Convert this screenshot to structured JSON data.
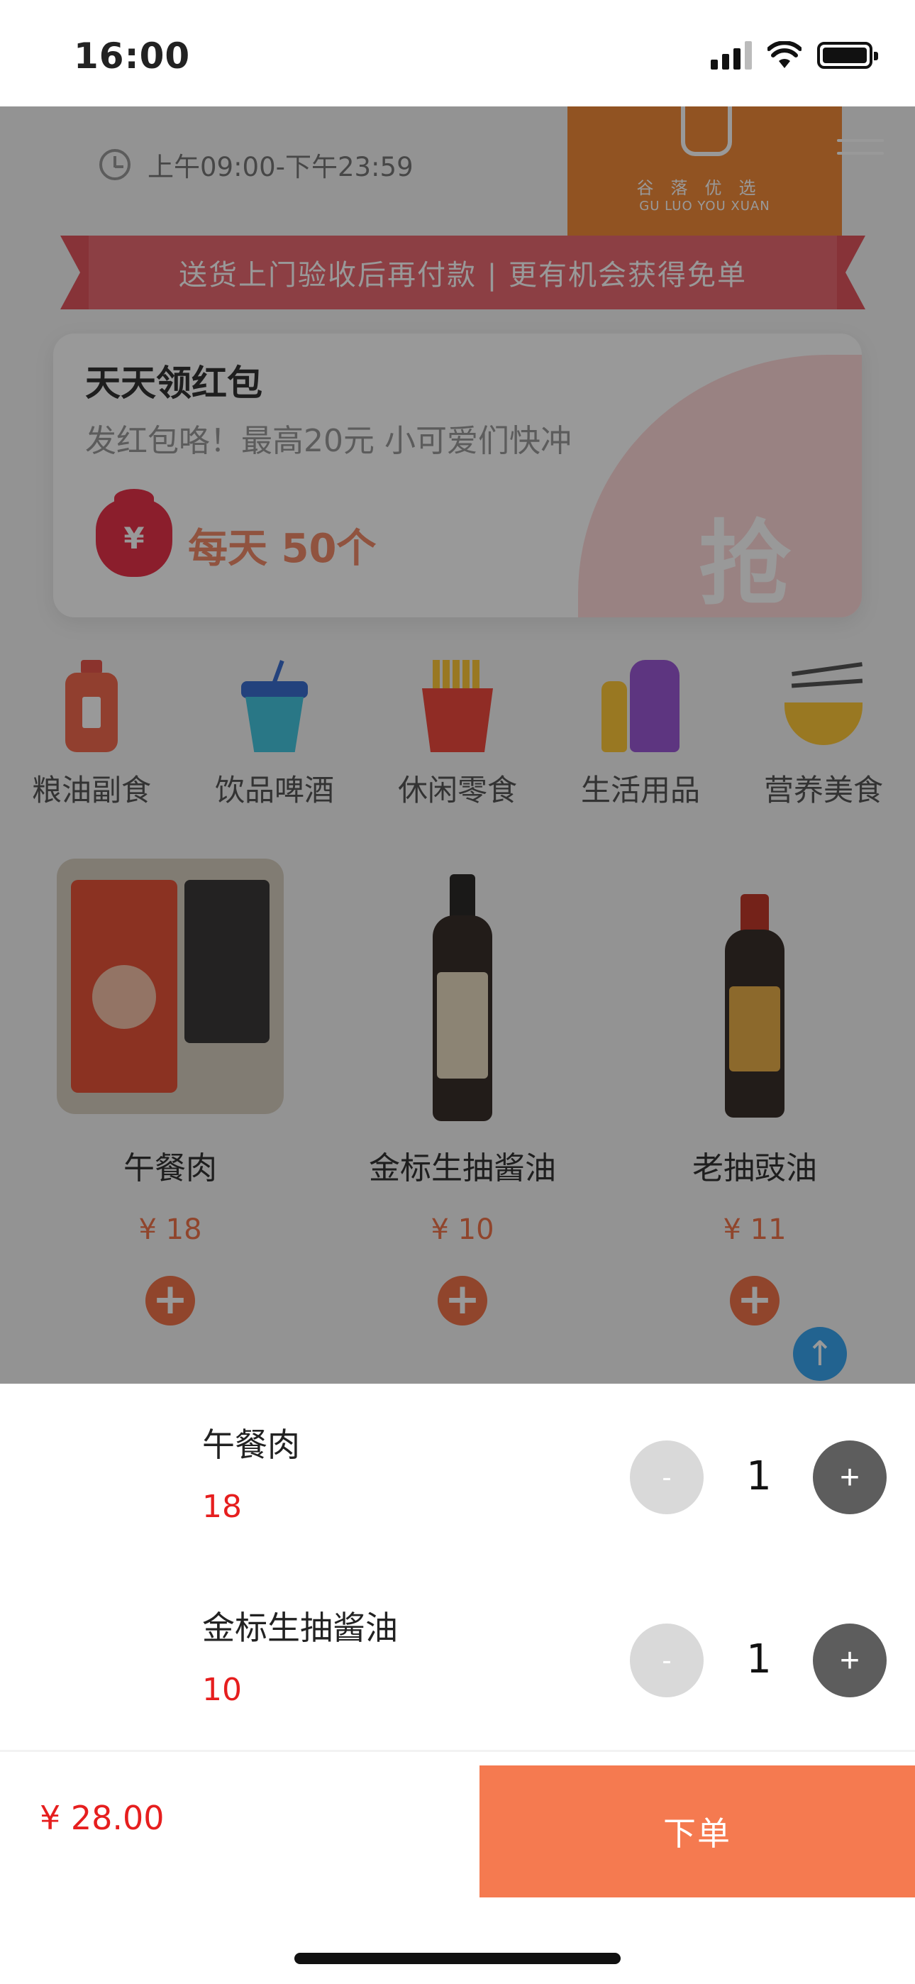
{
  "status_bar": {
    "time": "16:00"
  },
  "store": {
    "hours": "上午09:00-下午23:59",
    "logo_cn": "谷落优选",
    "logo_en": "GU LUO YOU XUAN"
  },
  "banner": {
    "text": "送货上门验收后再付款 | 更有机会获得免单"
  },
  "promo": {
    "title": "天天领红包",
    "subtitle": "发红包咯！最高20元 小可爱们快冲",
    "bag_symbol": "¥",
    "daily": "每天 50个",
    "grab": "抢"
  },
  "categories": [
    {
      "label": "粮油副食",
      "icon": "oil-bottle-icon"
    },
    {
      "label": "饮品啤酒",
      "icon": "drink-cup-icon"
    },
    {
      "label": "休闲零食",
      "icon": "fries-icon"
    },
    {
      "label": "生活用品",
      "icon": "detergent-bottle-icon"
    },
    {
      "label": "营养美食",
      "icon": "noodle-bowl-icon"
    }
  ],
  "products": [
    {
      "name": "午餐肉",
      "price": "¥ 18",
      "add": "+"
    },
    {
      "name": "金标生抽酱油",
      "price": "¥ 10",
      "add": "+"
    },
    {
      "name": "老抽豉油",
      "price": "¥ 11",
      "add": "+"
    }
  ],
  "scroll_top_icon": "arrow-up-icon",
  "cart": {
    "items": [
      {
        "name": "午餐肉",
        "price": "18",
        "minus": "-",
        "qty": "1",
        "plus": "+"
      },
      {
        "name": "金标生抽酱油",
        "price": "10",
        "minus": "-",
        "qty": "1",
        "plus": "+"
      }
    ],
    "total": "¥ 28.00",
    "order_button": "下单"
  },
  "colors": {
    "accent": "#f57a50",
    "price_red": "#e61e1e",
    "plus_button": "#5d5d5d",
    "minus_button": "#d9d9d9"
  }
}
